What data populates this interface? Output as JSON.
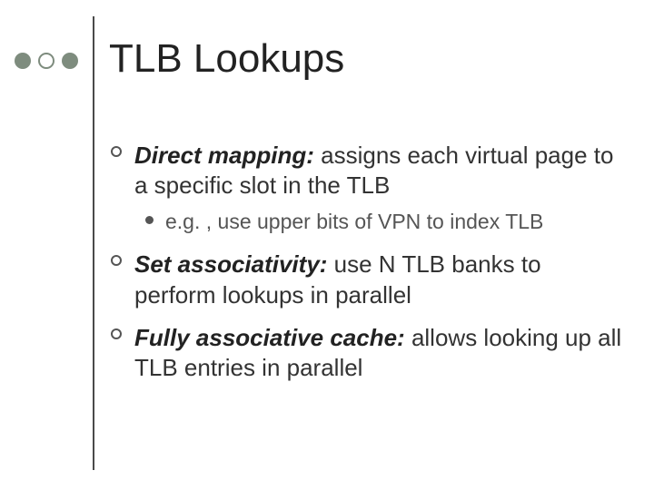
{
  "title": "TLB Lookups",
  "items": [
    {
      "term": "Direct mapping:",
      "desc": "  assigns each virtual page to a specific slot in the TLB",
      "sub": "e.g. , use upper bits of VPN to index TLB"
    },
    {
      "term": "Set associativity:",
      "desc": "  use N TLB banks to perform lookups in parallel"
    },
    {
      "term": "Fully associative cache:",
      "desc": "  allows looking up all TLB entries in parallel"
    }
  ]
}
